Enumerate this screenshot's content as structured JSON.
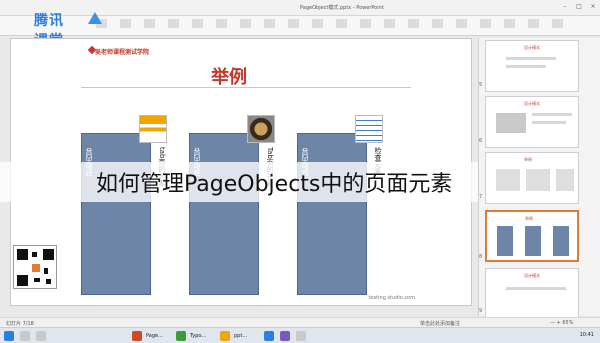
{
  "window": {
    "title": "PageObject模式.pptx - PowerPoint"
  },
  "watermark": {
    "logo_text": "腾讯课堂"
  },
  "slide": {
    "brand": "吴老师课程测试学院",
    "title": "举例",
    "cards": [
      {
        "label": "获取内容",
        "side_text": "tab页的元素"
      },
      {
        "label": "获取内容",
        "side_text": "Tab页的元素"
      },
      {
        "label": "获取内容",
        "side_text": "检查元素"
      }
    ],
    "bottom_note": "testing studio.com"
  },
  "caption": "如何管理PageObjects中的页面元素",
  "thumbnails": [
    {
      "num": "5",
      "title": "设计模式"
    },
    {
      "num": "6",
      "title": "设计模式"
    },
    {
      "num": "7",
      "title": "举例"
    },
    {
      "num": "8",
      "title": "举例"
    },
    {
      "num": "9",
      "title": "设计模式"
    }
  ],
  "status": {
    "left": "幻灯片 7/18",
    "notes": "单击此处添加备注",
    "zoom": "— + 65%"
  },
  "taskbar": {
    "items": [
      "Page...",
      "Typo...",
      "ppt..."
    ],
    "clock": "10:41"
  },
  "colors": {
    "accent": "#c0392b",
    "card": "#6d86a8",
    "active_border": "#e07b39"
  }
}
